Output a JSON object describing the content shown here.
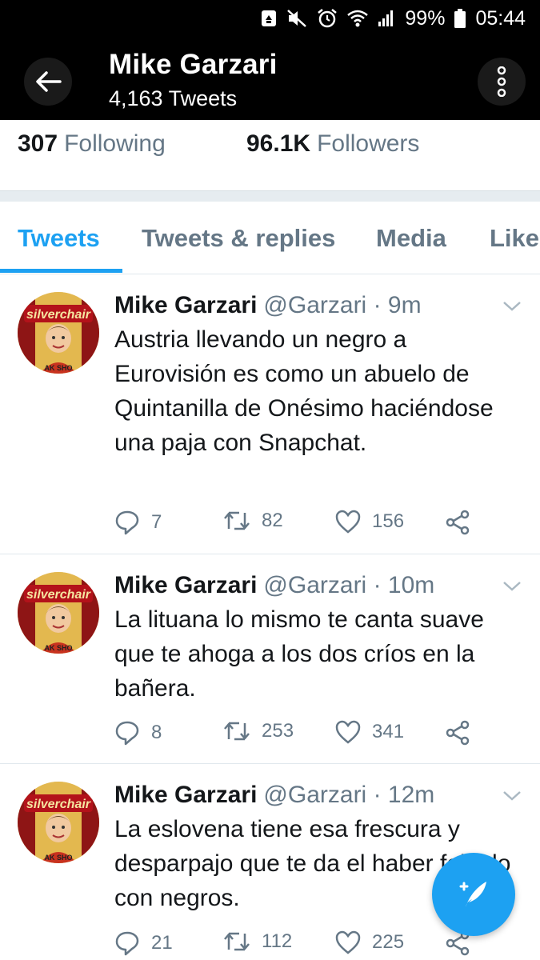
{
  "status_bar": {
    "battery_percent": "99%",
    "time": "05:44",
    "icons": [
      "recycle-icon",
      "mute-icon",
      "alarm-icon",
      "wifi-icon",
      "signal-icon",
      "battery-icon"
    ]
  },
  "header": {
    "title": "Mike Garzari",
    "subtitle": "4,163 Tweets",
    "back_icon": "arrow-left-icon",
    "more_icon": "more-vertical-icon"
  },
  "stats": {
    "following_count": "307",
    "following_label": "Following",
    "followers_count": "96.1K",
    "followers_label": "Followers"
  },
  "tabs": [
    {
      "label": "Tweets",
      "active": true
    },
    {
      "label": "Tweets & replies",
      "active": false
    },
    {
      "label": "Media",
      "active": false
    },
    {
      "label": "Likes",
      "active": false
    }
  ],
  "tweets": [
    {
      "name": "Mike Garzari",
      "handle": "@Garzari",
      "time": "· 9m",
      "text": "Austria llevando un negro a Eurovisión es como un abuelo de Quintanilla de Onésimo haciéndose una paja con Snapchat.",
      "replies": "7",
      "retweets": "82",
      "likes": "156"
    },
    {
      "name": "Mike Garzari",
      "handle": "@Garzari",
      "time": "· 10m",
      "text": "La lituana lo mismo te canta suave que te ahoga a los dos críos en la bañera.",
      "replies": "8",
      "retweets": "253",
      "likes": "341"
    },
    {
      "name": "Mike Garzari",
      "handle": "@Garzari",
      "time": "· 12m",
      "text": "La eslovena tiene esa frescura y desparpajo que te da el haber follado con negros.",
      "replies": "21",
      "retweets": "112",
      "likes": "225"
    }
  ],
  "avatar_text": "silverchair",
  "colors": {
    "accent": "#1da1f2",
    "text_primary": "#14171a",
    "text_secondary": "#657786",
    "header_bg": "#000000"
  },
  "fab_icon": "compose-tweet-icon"
}
